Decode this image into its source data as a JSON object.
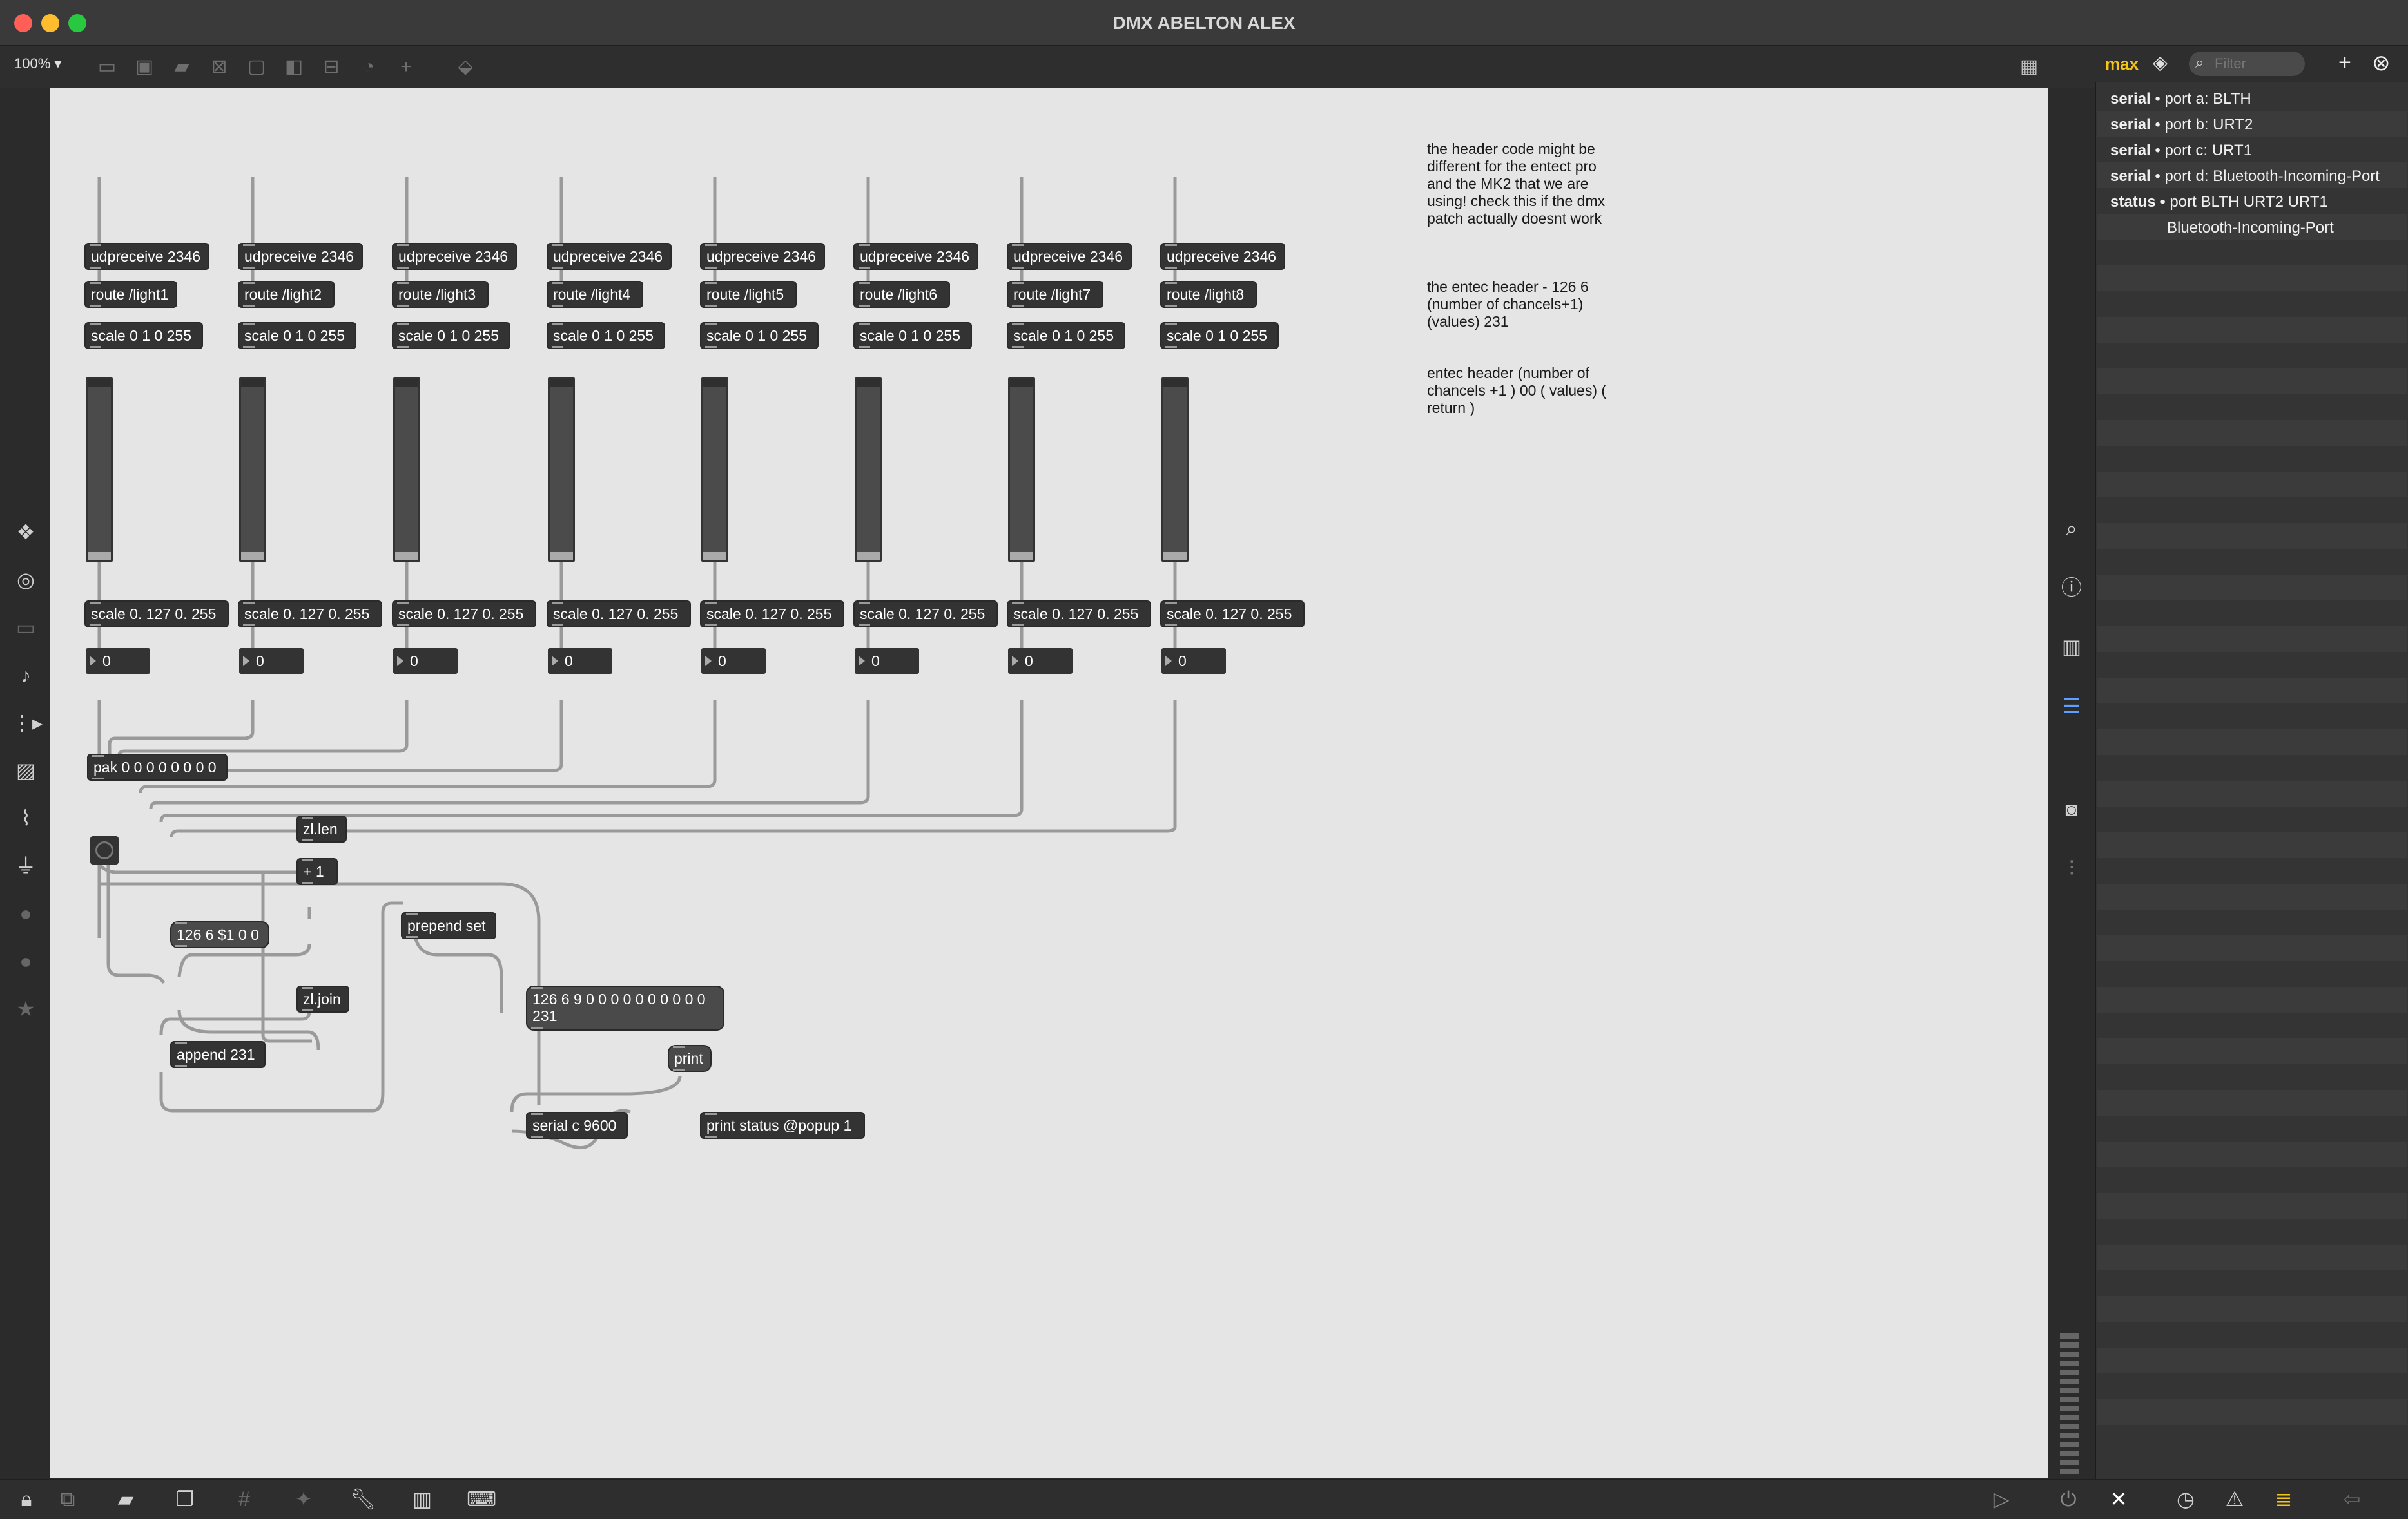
{
  "window": {
    "title": "DMX ABELTON ALEX",
    "traffic_colors": [
      "#ff5f57",
      "#febc2e",
      "#28c840"
    ]
  },
  "toolbar": {
    "zoom_label": "100%"
  },
  "max_console": {
    "title": "max",
    "filter_placeholder": "Filter",
    "messages": [
      {
        "source": "serial",
        "text": "• port a: BLTH"
      },
      {
        "source": "serial",
        "text": "• port b: URT2"
      },
      {
        "source": "serial",
        "text": "• port c: URT1"
      },
      {
        "source": "serial",
        "text": "• port d: Bluetooth-Incoming-Port"
      },
      {
        "source": "status",
        "text": "• port BLTH URT2 URT1"
      },
      {
        "source": "",
        "text": "Bluetooth-Incoming-Port"
      }
    ]
  },
  "patcher": {
    "channels": [
      {
        "udp": "udpreceive 2346",
        "route": "route /light1",
        "scale_in": "scale 0 1 0 255",
        "scale_out": "scale 0. 127 0. 255",
        "number": "0"
      },
      {
        "udp": "udpreceive 2346",
        "route": "route /light2",
        "scale_in": "scale 0 1 0 255",
        "scale_out": "scale 0. 127 0. 255",
        "number": "0"
      },
      {
        "udp": "udpreceive 2346",
        "route": "route /light3",
        "scale_in": "scale 0 1 0 255",
        "scale_out": "scale 0. 127 0. 255",
        "number": "0"
      },
      {
        "udp": "udpreceive 2346",
        "route": "route /light4",
        "scale_in": "scale 0 1 0 255",
        "scale_out": "scale 0. 127 0. 255",
        "number": "0"
      },
      {
        "udp": "udpreceive 2346",
        "route": "route /light5",
        "scale_in": "scale 0 1 0 255",
        "scale_out": "scale 0. 127 0. 255",
        "number": "0"
      },
      {
        "udp": "udpreceive 2346",
        "route": "route /light6",
        "scale_in": "scale 0 1 0 255",
        "scale_out": "scale 0. 127 0. 255",
        "number": "0"
      },
      {
        "udp": "udpreceive 2346",
        "route": "route /light7",
        "scale_in": "scale 0 1 0 255",
        "scale_out": "scale 0. 127 0. 255",
        "number": "0"
      },
      {
        "udp": "udpreceive 2346",
        "route": "route /light8",
        "scale_in": "scale 0 1 0 255",
        "scale_out": "scale 0. 127 0. 255",
        "number": "0"
      }
    ],
    "objects": {
      "pak": "pak 0 0 0 0 0 0 0 0",
      "zl_len": "zl.len",
      "plus_one": "+ 1",
      "header_msg": "126 6 $1 0 0",
      "zl_join": "zl.join",
      "append": "append 231",
      "prepend": "prepend set",
      "display_msg_line1": "126 6 9 0 0 0 0 0 0 0 0 0 0",
      "display_msg_line2": "231",
      "print": "print",
      "serial": "serial c 9600",
      "print_status": "print status @popup 1"
    },
    "comments": {
      "c1": "the header code might be different for the entect pro and the MK2 that we are using! check this if the dmx patch actually doesnt work",
      "c2": "the entec header - 126 6 (number of chancels+1) (values) 231",
      "c3": "entec header (number of chancels +1 ) 00 ( values) ( return )"
    }
  }
}
